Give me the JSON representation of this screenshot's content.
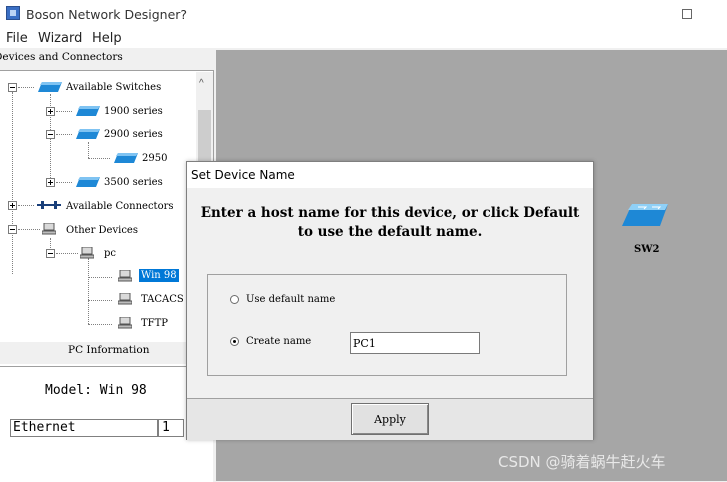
{
  "window": {
    "title": "Boson Network Designer?"
  },
  "menu": [
    "File",
    "Wizard",
    "Help"
  ],
  "left_panel": {
    "header": "Devices and Connectors",
    "tree": {
      "available_switches": "Available Switches",
      "series_1900": "1900 series",
      "series_2900": "2900 series",
      "model_2950": "2950",
      "series_3500": "3500 series",
      "available_connectors": "Available Connectors",
      "other_devices": "Other Devices",
      "pc": "pc",
      "win98": "Win 98",
      "tacacs": "TACACS",
      "tftp": "TFTP"
    },
    "info_header": "PC Information",
    "model": "Model: Win 98",
    "ethernet_label": "Ethernet",
    "ethernet_count": "1"
  },
  "workspace": {
    "device_label": "SW2"
  },
  "dialog": {
    "title": "Set Device Name",
    "message": "Enter a host name for this device, or click Default to use the default name.",
    "option_default": "Use default name",
    "option_create": "Create name",
    "selected_option": "Create name",
    "name_value": "PC1",
    "apply_label": "Apply"
  },
  "watermark": "CSDN @骑着蜗牛赶火车",
  "colors": {
    "selection": "#0078d7",
    "workspace": "#a6a6a6",
    "switch_icon": "#1e88d6"
  }
}
